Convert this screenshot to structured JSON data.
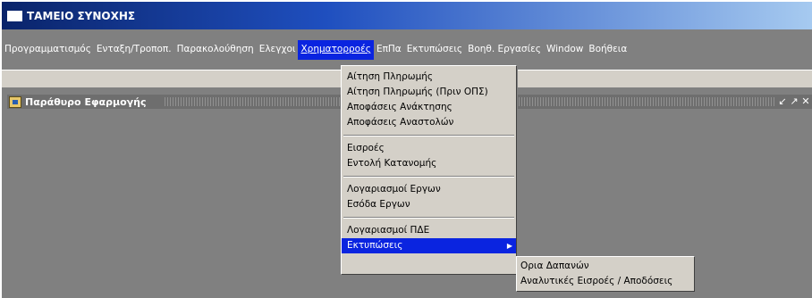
{
  "window": {
    "title": "ΤΑΜΕΙΟ ΣΥΝΟΧΗΣ"
  },
  "menubar": {
    "items": [
      "Προγραμματισμός",
      "Ενταξη/Τροποπ.",
      "Παρακολούθηση",
      "Ελεγχοι",
      "Χρηματορροές",
      "ΕπΠα",
      "Εκτυπώσεις",
      "Βοηθ. Εργασίες",
      "Window",
      "Βοήθεια"
    ],
    "active": "Χρηματορροές"
  },
  "inner_window": {
    "title": "Παράθυρο Εφαρμογής"
  },
  "dropdown": {
    "groups": [
      [
        "Αίτηση Πληρωμής",
        "Αίτηση Πληρωμής (Πριν ΟΠΣ)",
        "Αποφάσεις Ανάκτησης",
        "Αποφάσεις Αναστολών"
      ],
      [
        "Εισροές",
        "Εντολή Κατανομής"
      ],
      [
        "Λογαριασμοί  Εργων",
        "Εσόδα Εργων"
      ],
      [
        "Λογαριασμοί ΠΔΕ",
        "Εκτυπώσεις"
      ]
    ],
    "highlighted": "Εκτυπώσεις"
  },
  "submenu": {
    "items": [
      "Ορια Δαπανών",
      "Αναλυτικές Εισροές / Αποδόσεις"
    ]
  }
}
